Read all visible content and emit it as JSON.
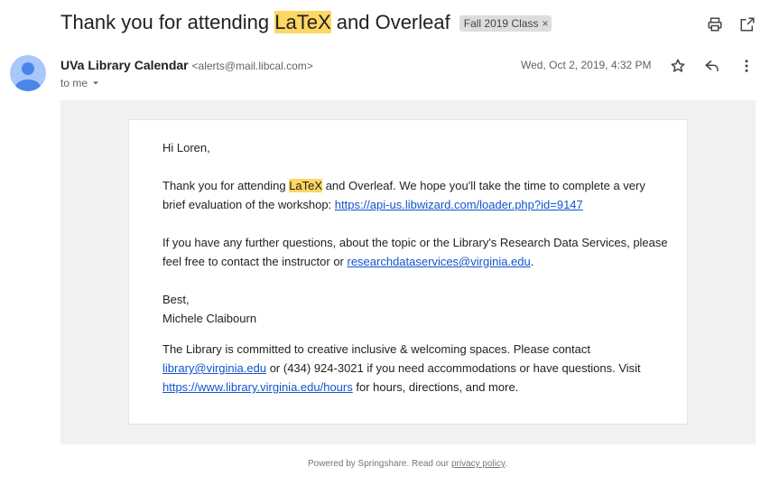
{
  "email": {
    "subject_before": "Thank you for attending ",
    "subject_highlight": "LaTeX",
    "subject_after": " and Overleaf",
    "label": "Fall 2019 Class",
    "label_remove": "×",
    "sender_name": "UVa Library Calendar",
    "sender_email": "<alerts@mail.libcal.com>",
    "recipient": "to me",
    "date": "Wed, Oct 2, 2019, 4:32 PM"
  },
  "body": {
    "greeting": "Hi Loren,",
    "p1_before": "Thank you for attending ",
    "p1_highlight": "LaTeX",
    "p1_after": " and Overleaf. We hope you'll take the time to complete a very brief evaluation of the workshop: ",
    "p1_link": "https://api-us.libwizard.com/loader.php?id=9147",
    "p2_text": "If you have any further questions, about the topic or the Library's Research Data Services, please feel free to contact the instructor or ",
    "p2_link": "researchdataservices@virginia.edu",
    "p2_end": ".",
    "signoff": "Best,",
    "signature": "Michele Claibourn",
    "p3_text": "The Library is committed to creative inclusive & welcoming spaces. Please contact ",
    "p3_link1": "library@virginia.edu",
    "p3_mid": " or (434) 924-3021 if you need accommodations or have questions. Visit ",
    "p3_link2": "https://www.library.virginia.edu/hours",
    "p3_end": " for hours, directions, and more."
  },
  "footer": {
    "text": "Powered by Springshare. Read our ",
    "link": "privacy policy",
    "end": "."
  },
  "icons": {
    "print": "print-icon",
    "open_new": "open-in-new-window-icon",
    "star": "star-icon",
    "reply": "reply-icon",
    "more": "more-vertical-icon",
    "dropdown": "caret-down-icon",
    "avatar": "person-icon"
  },
  "colors": {
    "highlight": "#fdd663",
    "link": "#1155cc",
    "panel_bg": "#f1f1f1",
    "avatar_bg": "#a8c7fa",
    "avatar_fg": "#4a86e8"
  }
}
